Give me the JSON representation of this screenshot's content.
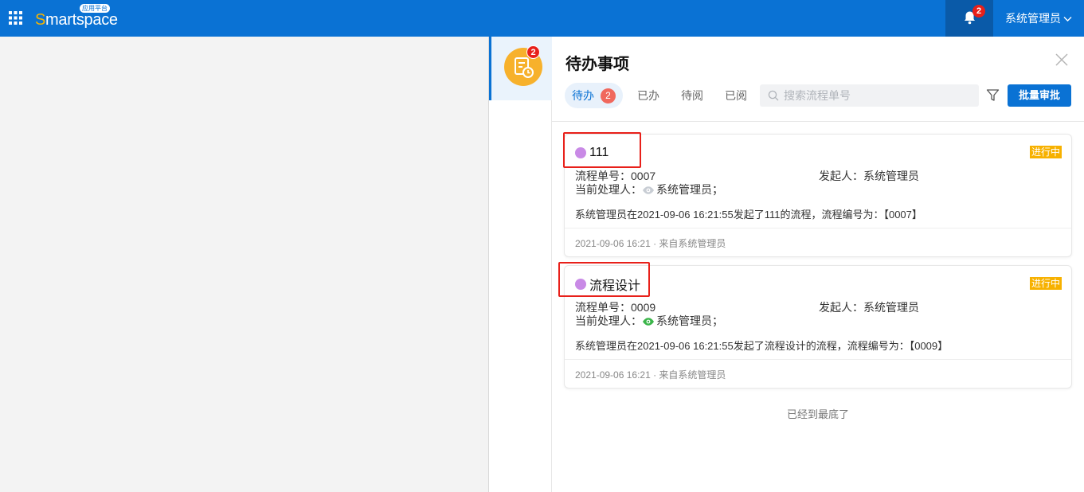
{
  "app": {
    "logo_first": "S",
    "logo_rest": "martspace",
    "logo_badge": "应用平台",
    "notification_count": "2",
    "user_name": "系统管理员"
  },
  "rail": {
    "badge": "2",
    "icon": "todo-clock-icon"
  },
  "panel": {
    "title": "待办事项",
    "tabs": [
      {
        "label": "待办",
        "badge": "2",
        "active": true
      },
      {
        "label": "已办"
      },
      {
        "label": "待阅"
      },
      {
        "label": "已阅"
      }
    ],
    "search_placeholder": "搜索流程单号",
    "batch_button": "批量审批",
    "end_text": "已经到最底了"
  },
  "cards": [
    {
      "title": "111",
      "status": "进行中",
      "order_label": "流程单号：",
      "order_no": "0007",
      "initiator_label": "发起人：",
      "initiator": "系统管理员",
      "handler_label": "当前处理人：",
      "handler": "系统管理员；",
      "handler_eye_color": "#c8cdd4",
      "description": "系统管理员在2021-09-06 16:21:55发起了111的流程，流程编号为：【0007】",
      "footer": "2021-09-06 16:21 · 来自系统管理员"
    },
    {
      "title": "流程设计",
      "status": "进行中",
      "order_label": "流程单号：",
      "order_no": "0009",
      "initiator_label": "发起人：",
      "initiator": "系统管理员",
      "handler_label": "当前处理人：",
      "handler": "系统管理员；",
      "handler_eye_color": "#3bb54a",
      "description": "系统管理员在2021-09-06 16:21:55发起了流程设计的流程，流程编号为：【0009】",
      "footer": "2021-09-06 16:21 · 来自系统管理员"
    }
  ],
  "colors": {
    "primary": "#0a72d4",
    "status": "#f7b100",
    "badge": "#e8201a",
    "highlight": "#e8201a"
  }
}
